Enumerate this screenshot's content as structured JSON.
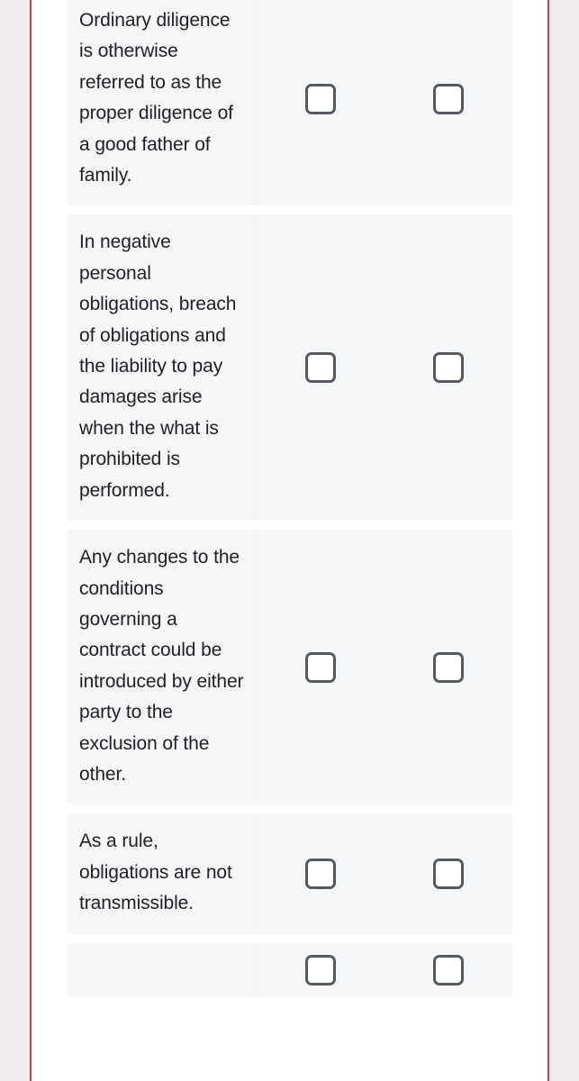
{
  "theme": {
    "page_background": "#f1ecec",
    "sheet_background": "#ffffff",
    "rule_color": "#b5484f",
    "card_background": "#f5f6f8",
    "text_color": "#1f2023",
    "checkbox_border": "#555a60",
    "checkbox_fill": "#ffffff"
  },
  "questions": [
    {
      "id": "q-ordinary-diligence",
      "statement": "Ordinary diligence is otherwise referred to as the proper diligence of a good father of family.",
      "options": [
        {
          "name": "true-checkbox",
          "checked": false
        },
        {
          "name": "false-checkbox",
          "checked": false
        }
      ]
    },
    {
      "id": "q-negative-personal-obligations",
      "statement": "In negative personal obligations, breach of obligations and the liability to pay damages arise when the what is prohibited is performed.",
      "options": [
        {
          "name": "true-checkbox",
          "checked": false
        },
        {
          "name": "false-checkbox",
          "checked": false
        }
      ]
    },
    {
      "id": "q-changes-to-conditions",
      "statement": "Any changes to the conditions governing a contract could be introduced by either party to the exclusion of the other.",
      "options": [
        {
          "name": "true-checkbox",
          "checked": false
        },
        {
          "name": "false-checkbox",
          "checked": false
        }
      ]
    },
    {
      "id": "q-obligations-not-transmissible",
      "statement": "As a rule, obligations are not transmissible.",
      "options": [
        {
          "name": "true-checkbox",
          "checked": false
        },
        {
          "name": "false-checkbox",
          "checked": false
        }
      ]
    },
    {
      "id": "q-next-partial",
      "statement": "",
      "options": [
        {
          "name": "true-checkbox",
          "checked": false
        },
        {
          "name": "false-checkbox",
          "checked": false
        }
      ]
    }
  ]
}
